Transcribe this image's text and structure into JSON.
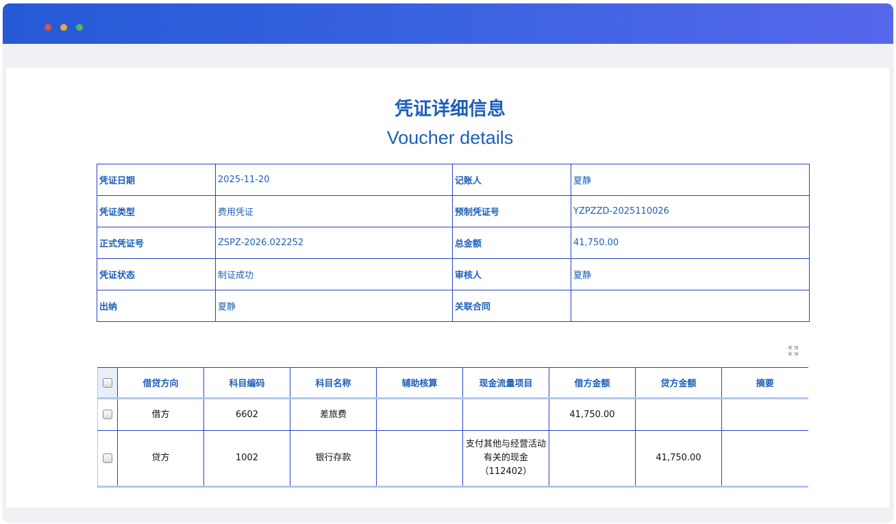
{
  "title_cn": "凭证详细信息",
  "title_en": "Voucher details",
  "info": {
    "voucher_date_label": "凭证日期",
    "voucher_date": "2025-11-20",
    "bookkeeper_label": "记账人",
    "bookkeeper": "夏静",
    "voucher_type_label": "凭证类型",
    "voucher_type": "费用凭证",
    "pre_voucher_no_label": "预制凭证号",
    "pre_voucher_no": "YZPZZD-2025110026",
    "formal_voucher_no_label": "正式凭证号",
    "formal_voucher_no": "ZSPZ-2026.022252",
    "total_amount_label": "总金额",
    "total_amount": "41,750.00",
    "voucher_status_label": "凭证状态",
    "voucher_status": "制证成功",
    "reviewer_label": "审核人",
    "reviewer": "夏静",
    "cashier_label": "出纳",
    "cashier": "夏静",
    "related_contract_label": "关联合同",
    "related_contract": ""
  },
  "grid": {
    "headers": [
      "借贷方向",
      "科目编码",
      "科目名称",
      "辅助核算",
      "现金流量项目",
      "借方金额",
      "贷方金额",
      "摘要"
    ],
    "rows": [
      {
        "direction": "借方",
        "code": "6602",
        "name": "差旅费",
        "aux": "",
        "cash_flow": "",
        "debit": "41,750.00",
        "credit": "",
        "summary": ""
      },
      {
        "direction": "贷方",
        "code": "1002",
        "name": "银行存款",
        "aux": "",
        "cash_flow": "支付其他与经营活动有关的现金（112402）",
        "debit": "",
        "credit": "41,750.00",
        "summary": ""
      }
    ]
  },
  "icons": {
    "expand": "expand-icon",
    "window_dots": [
      "close-dot",
      "minimize-dot",
      "maximize-dot"
    ]
  },
  "colors": {
    "titlebar_start": "#2559d6",
    "titlebar_end": "#5667ea",
    "text_blue": "#1d5fb8",
    "border_blue": "#2441c8"
  }
}
